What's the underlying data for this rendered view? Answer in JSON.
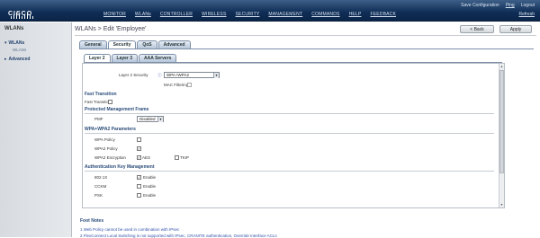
{
  "header": {
    "brand": "CISCO",
    "nav": [
      "MONITOR",
      "WLANs",
      "CONTROLLER",
      "WIRELESS",
      "SECURITY",
      "MANAGEMENT",
      "COMMANDS",
      "HELP",
      "FEEDBACK"
    ],
    "links": [
      "Save Configuration",
      "Ping",
      "Logout",
      "Refresh"
    ]
  },
  "sidebar": {
    "title": "WLANs",
    "items": [
      {
        "label": "WLANs",
        "sub": "WLANs"
      },
      {
        "label": "Advanced"
      }
    ]
  },
  "page": {
    "title": "WLANs > Edit  'Employee'",
    "back_label": "< Back",
    "apply_label": "Apply"
  },
  "tabs": [
    "General",
    "Security",
    "QoS",
    "Advanced"
  ],
  "subtabs": [
    "Layer 2",
    "Layer 3",
    "AAA Servers"
  ],
  "form": {
    "layer2_security_label": "Layer 2 Security",
    "layer2_security_value": "WPA+WPA2",
    "mac_filtering_label": "MAC Filtering",
    "fast_transition_section": "Fast Transition",
    "fast_transition_label": "Fast Transition",
    "pmf_section": "Protected Management Frame",
    "pmf_label": "PMF",
    "pmf_value": "Disabled",
    "wpa_section": "WPA+WPA2 Parameters",
    "wpa_policy_label": "WPA Policy",
    "wpa2_policy_label": "WPA2 Policy",
    "wpa2_encryption_label": "WPA2 Encryption",
    "aes_label": "AES",
    "tkip_label": "TKIP",
    "akm_section": "Authentication Key Management",
    "akm_rows": [
      {
        "label": "802.1X",
        "enable": "Enable",
        "checked": true
      },
      {
        "label": "CCKM",
        "enable": "Enable",
        "checked": false
      },
      {
        "label": "PSK",
        "enable": "Enable",
        "checked": false
      }
    ]
  },
  "foot": {
    "title": "Foot Notes",
    "notes": [
      "1 Web Policy cannot be used in combination with IPsec",
      "2 FlexConnect Local Switching is not supported with IPsec, CRANITE authentication, Override Interface ACLs"
    ]
  }
}
